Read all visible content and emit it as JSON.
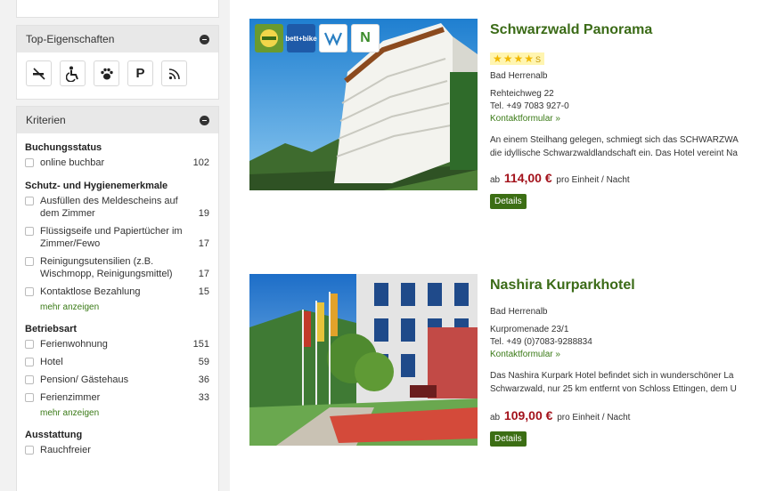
{
  "sidebar": {
    "top_properties": {
      "title": "Top-Eigenschaften",
      "icons": [
        {
          "name": "no-smoking-icon",
          "glyph": "⚡"
        },
        {
          "name": "wheelchair-icon",
          "glyph": "♿"
        },
        {
          "name": "pet-paw-icon",
          "glyph": "🐾"
        },
        {
          "name": "parking-icon",
          "glyph": "P"
        },
        {
          "name": "wifi-icon",
          "glyph": "📶"
        }
      ]
    },
    "criteria": {
      "title": "Kriterien",
      "groups": [
        {
          "title": "Buchungsstatus",
          "items": [
            {
              "label": "online buchbar",
              "count": "102"
            }
          ]
        },
        {
          "title": "Schutz- und Hygienemerkmale",
          "items": [
            {
              "label": "Ausfüllen des Meldescheins auf dem Zimmer",
              "count": "19"
            },
            {
              "label": "Flüssigseife und Papiertücher im Zimmer/Fewo",
              "count": "17"
            },
            {
              "label": "Reinigungsutensilien (z.B. Wischmopp, Reinigungsmittel)",
              "count": "17"
            },
            {
              "label": "Kontaktlose Bezahlung",
              "count": "15"
            }
          ],
          "more": "mehr anzeigen"
        },
        {
          "title": "Betriebsart",
          "items": [
            {
              "label": "Ferienwohnung",
              "count": "151"
            },
            {
              "label": "Hotel",
              "count": "59"
            },
            {
              "label": "Pension/ Gästehaus",
              "count": "36"
            },
            {
              "label": "Ferienzimmer",
              "count": "33"
            }
          ],
          "more": "mehr anzeigen"
        },
        {
          "title": "Ausstattung",
          "items": [
            {
              "label": "Rauchfreier",
              "count": ""
            }
          ]
        }
      ]
    }
  },
  "listings": [
    {
      "name": "Schwarzwald Panorama",
      "stars": "★★★★",
      "stars_suffix": "S",
      "town": "Bad Herrenalb",
      "street": "Rehteichweg 22",
      "phone": "Tel.  +49 7083 927-0",
      "contact": "Kontaktformular »",
      "desc1": "An einem Steilhang gelegen, schmiegt sich das SCHWARZWA",
      "desc2": "die idyllische Schwarzwaldlandschaft ein. Das Hotel vereint Na",
      "price_prefix": "ab",
      "price": "114,00 €",
      "price_suffix": "pro Einheit / Nacht",
      "details": "Details",
      "badges": [
        "",
        "bett+bike",
        "",
        "N"
      ]
    },
    {
      "name": "Nashira Kurparkhotel",
      "town": "Bad Herrenalb",
      "street": "Kurpromenade 23/1",
      "phone": "Tel.  +49 (0)7083-9288834",
      "contact": "Kontaktformular »",
      "desc1": "Das Nashira Kurpark Hotel befindet sich in wunderschöner La",
      "desc2": "Schwarzwald, nur 25 km entfernt von Schloss Ettingen, dem U",
      "price_prefix": "ab",
      "price": "109,00 €",
      "price_suffix": "pro Einheit / Nacht",
      "details": "Details"
    }
  ]
}
